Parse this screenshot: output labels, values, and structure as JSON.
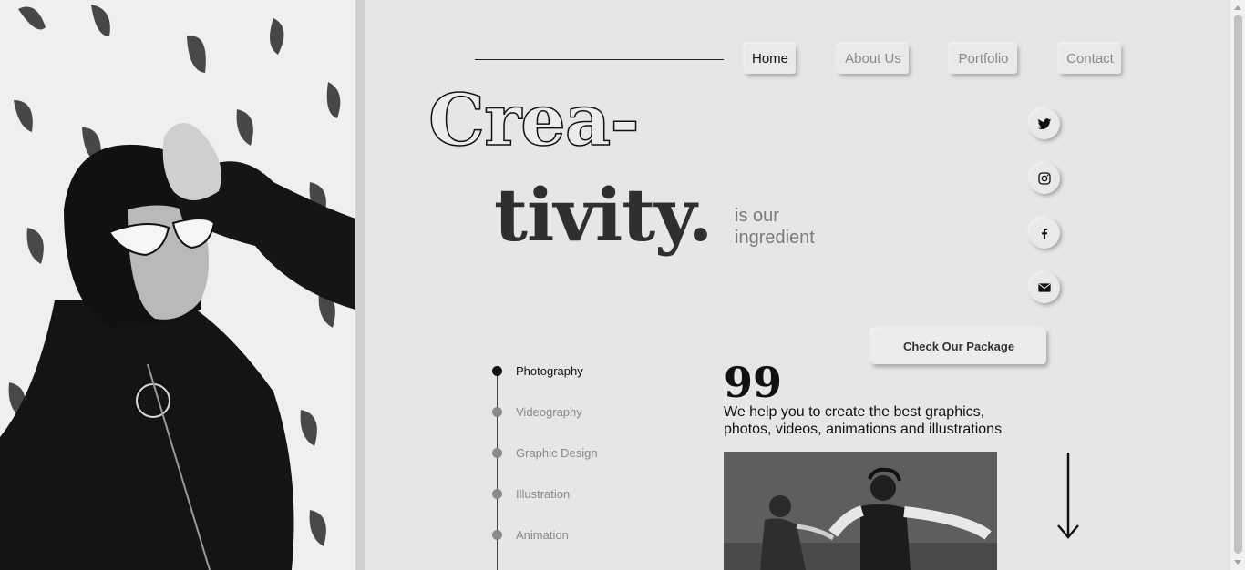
{
  "nav": {
    "items": [
      {
        "label": "Home",
        "active": true
      },
      {
        "label": "About Us",
        "active": false
      },
      {
        "label": "Portfolio",
        "active": false
      },
      {
        "label": "Contact",
        "active": false
      }
    ]
  },
  "hero": {
    "headline_line1": "Crea-",
    "headline_line2": "tivity.",
    "tagline_line1": "is our",
    "tagline_line2": "ingredient"
  },
  "social": [
    {
      "icon": "twitter-icon"
    },
    {
      "icon": "instagram-icon"
    },
    {
      "icon": "facebook-icon"
    },
    {
      "icon": "mail-icon"
    }
  ],
  "cta": {
    "label": "Check Our Package"
  },
  "services": {
    "items": [
      {
        "label": "Photography",
        "active": true
      },
      {
        "label": "Videography",
        "active": false
      },
      {
        "label": "Graphic Design",
        "active": false
      },
      {
        "label": "Illustration",
        "active": false
      },
      {
        "label": "Animation",
        "active": false
      }
    ]
  },
  "quote": {
    "mark": "99",
    "text": "We help you to create the best graphics, photos, videos, animations and illustrations"
  },
  "colors": {
    "background": "#e6e6e6",
    "text_dark": "#111111",
    "text_muted": "#8a8a8a",
    "headline_fill": "#2f2f2f"
  }
}
